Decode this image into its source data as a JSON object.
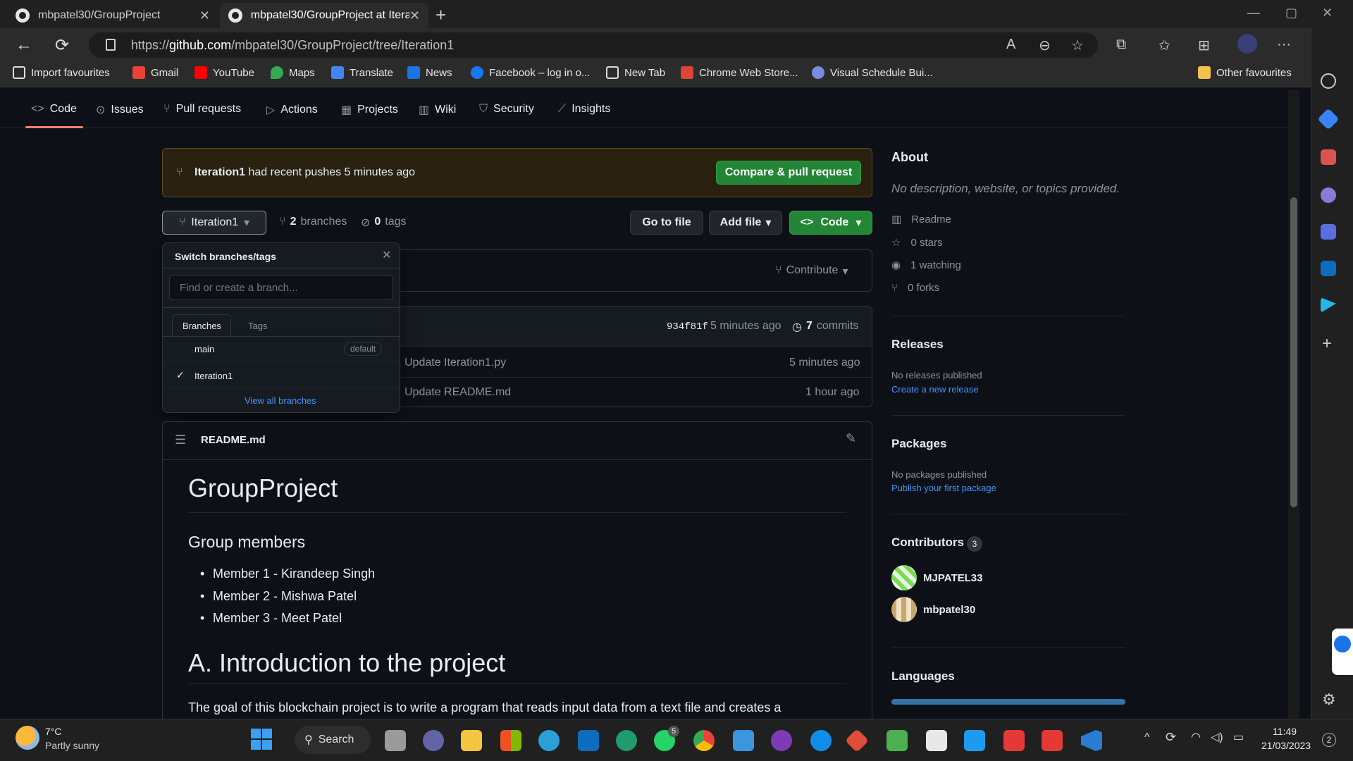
{
  "browser": {
    "tabs": [
      {
        "title": "mbpatel30/GroupProject"
      },
      {
        "title": "mbpatel30/GroupProject at Itera"
      }
    ],
    "url_prefix": "https://",
    "url_host": "github.com",
    "url_path": "/mbpatel30/GroupProject/tree/Iteration1",
    "favourites": [
      "Import favourites",
      "Gmail",
      "YouTube",
      "Maps",
      "Translate",
      "News",
      "Facebook – log in o...",
      "New Tab",
      "Chrome Web Store...",
      "Visual Schedule Bui..."
    ],
    "other_favourites": "Other favourites"
  },
  "repo_nav": [
    "Code",
    "Issues",
    "Pull requests",
    "Actions",
    "Projects",
    "Wiki",
    "Security",
    "Insights"
  ],
  "banner": {
    "branch": "Iteration1",
    "text": " had recent pushes 5 minutes ago",
    "button": "Compare & pull request"
  },
  "toolbar": {
    "branch": "Iteration1",
    "branches_count": "2",
    "branches_label": "branches",
    "tags_count": "0",
    "tags_label": "tags",
    "go_to_file": "Go to file",
    "add_file": "Add file",
    "code": "Code",
    "contribute": "Contribute"
  },
  "commit_bar": {
    "sha": "934f81f",
    "time": "5 minutes ago",
    "commits_count": "7",
    "commits_label": "commits"
  },
  "files": [
    {
      "message": "Update Iteration1.py",
      "time": "5 minutes ago"
    },
    {
      "message": "Update README.md",
      "time": "1 hour ago"
    }
  ],
  "dropdown": {
    "title": "Switch branches/tags",
    "placeholder": "Find or create a branch...",
    "tab_branches": "Branches",
    "tab_tags": "Tags",
    "branches": [
      {
        "name": "main",
        "badge": "default"
      },
      {
        "name": "Iteration1"
      }
    ],
    "view_all": "View all branches"
  },
  "readme": {
    "filename": "README.md",
    "h1": "GroupProject",
    "h2": "Group members",
    "members": [
      "Member 1 - Kirandeep Singh",
      "Member 2 - Mishwa Patel",
      "Member 3 - Meet Patel"
    ],
    "h2b": "A. Introduction to the project",
    "paragraph": "The goal of this blockchain project is to write a program that reads input data from a text file and creates a"
  },
  "about": {
    "title": "About",
    "description": "No description, website, or topics provided.",
    "readme": "Readme",
    "stars": "0 stars",
    "watching": "1 watching",
    "forks": "0 forks"
  },
  "releases": {
    "title": "Releases",
    "text": "No releases published",
    "link": "Create a new release"
  },
  "packages": {
    "title": "Packages",
    "text": "No packages published",
    "link": "Publish your first package"
  },
  "contributors": {
    "title": "Contributors",
    "count": "3",
    "list": [
      "MJPATEL33",
      "mbpatel30"
    ]
  },
  "languages": {
    "title": "Languages",
    "python_fraction": 1.0
  },
  "taskbar": {
    "weather_temp": "7°C",
    "weather_desc": "Partly sunny",
    "search": "Search",
    "whatsapp_badge": "5",
    "time": "11:49",
    "date": "21/03/2023",
    "notif_count": "2"
  },
  "colors": {
    "accent_green": "#238636",
    "link_blue": "#4493f8",
    "underline_orange": "#f78166",
    "language_python": "#3572a5"
  }
}
